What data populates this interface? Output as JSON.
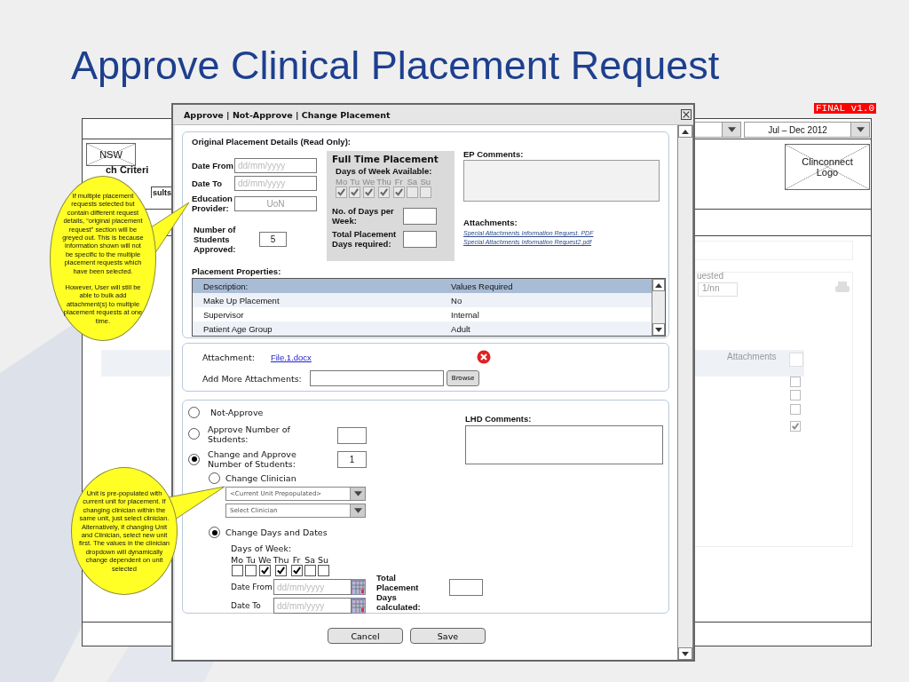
{
  "slide_title": "Approve Clinical Placement Request",
  "version_badge": "FINAL v1.0",
  "background_window": {
    "period": "Jul – Dec 2012",
    "state_image": "NSW",
    "heading": "ch Criteri",
    "tab": "sults",
    "logo": "Clinconnect Logo",
    "requested_label": "uested",
    "requested_value": "1/nn",
    "column_header": "Attachments",
    "row_checks": [
      {
        "checked": false
      },
      {
        "checked": false
      },
      {
        "checked": false
      },
      {
        "checked": true
      }
    ]
  },
  "dialog": {
    "title": "Approve | Not-Approve | Change Placement",
    "original": {
      "heading": "Original Placement Details (Read Only):",
      "date_from": {
        "label": "Date From",
        "placeholder": "dd/mm/yyyy"
      },
      "date_to": {
        "label": "Date To",
        "placeholder": "dd/mm/yyyy"
      },
      "provider": {
        "label": "Education Provider:",
        "value": "UoN"
      },
      "students": {
        "label": "Number of Students Approved:",
        "value": "5"
      },
      "full_time": {
        "title": "Full Time Placement",
        "days_label": "Days of Week Available:",
        "disabled": true,
        "days": [
          {
            "label": "Mo",
            "checked": true
          },
          {
            "label": "Tu",
            "checked": true
          },
          {
            "label": "We",
            "checked": true
          },
          {
            "label": "Thu",
            "checked": true
          },
          {
            "label": "Fr",
            "checked": true
          },
          {
            "label": "Sa",
            "checked": false
          },
          {
            "label": "Su",
            "checked": false
          }
        ],
        "days_per_week": "No. of Days per Week:",
        "total_days": "Total Placement Days required:"
      },
      "ep_comments": "EP Comments:",
      "attachments": {
        "label": "Attachments:",
        "links": [
          "Special Attachments Information Request. PDF",
          "Special Attachments Information Request2.pdf"
        ]
      },
      "properties": {
        "heading": "Placement Properties:",
        "columns": [
          "Description:",
          "Values Required"
        ],
        "rows": [
          [
            "Make Up Placement",
            "No"
          ],
          [
            "Supervisor",
            "Internal"
          ],
          [
            "Patient Age Group",
            "Adult"
          ]
        ]
      }
    },
    "attachment": {
      "label": "Attachment:",
      "file": "File.1.docx",
      "add_label": "Add More Attachments:",
      "browse": "Browse"
    },
    "decision": {
      "options": [
        {
          "label": "Not-Approve",
          "selected": false,
          "kind": "plain"
        },
        {
          "label": "Approve Number of Students:",
          "selected": false,
          "kind": "count"
        },
        {
          "label": "Change and Approve Number of Students:",
          "selected": true,
          "kind": "count",
          "value": "1"
        }
      ],
      "changes": [
        {
          "kind": "clinician",
          "label": "Change Clinician",
          "selected": false,
          "dropdowns": [
            "<Current Unit Prepopulated>",
            "Select Clinician"
          ]
        },
        {
          "kind": "dates",
          "label": "Change Days and Dates",
          "selected": true,
          "days_label": "Days of Week:",
          "disabled": false,
          "days": [
            {
              "label": "Mo",
              "checked": false
            },
            {
              "label": "Tu",
              "checked": false
            },
            {
              "label": "We",
              "checked": true
            },
            {
              "label": "Thu",
              "checked": true
            },
            {
              "label": "Fr",
              "checked": true
            },
            {
              "label": "Sa",
              "checked": false
            },
            {
              "label": "Su",
              "checked": false
            }
          ],
          "date_from": {
            "label": "Date From",
            "placeholder": "dd/mm/yyyy"
          },
          "date_to": {
            "label": "Date To",
            "placeholder": "dd/mm/yyyy"
          },
          "total_label": "Total Placement Days calculated:"
        }
      ],
      "lhd_comments": "LHD Comments:"
    },
    "buttons": [
      "Cancel",
      "Save"
    ]
  },
  "callouts": [
    {
      "paragraphs": [
        "If multiple placement requests selected but contain different request details, “original placement request” section will be greyed out. This is because information shown will not be specific to the multiple placement requests which have been selected.",
        "However, User will still be able to bulk add attachment(s) to multiple placement requests at one time."
      ]
    },
    {
      "paragraphs": [
        "Unit is pre-populated with current unit for placement. If changing clinician within the same unit, just select clinician. Alternatively, if changing Unit and Clinician, select new unit first. The values in the clinician dropdown will dynamically change dependent on unit selected"
      ]
    }
  ]
}
